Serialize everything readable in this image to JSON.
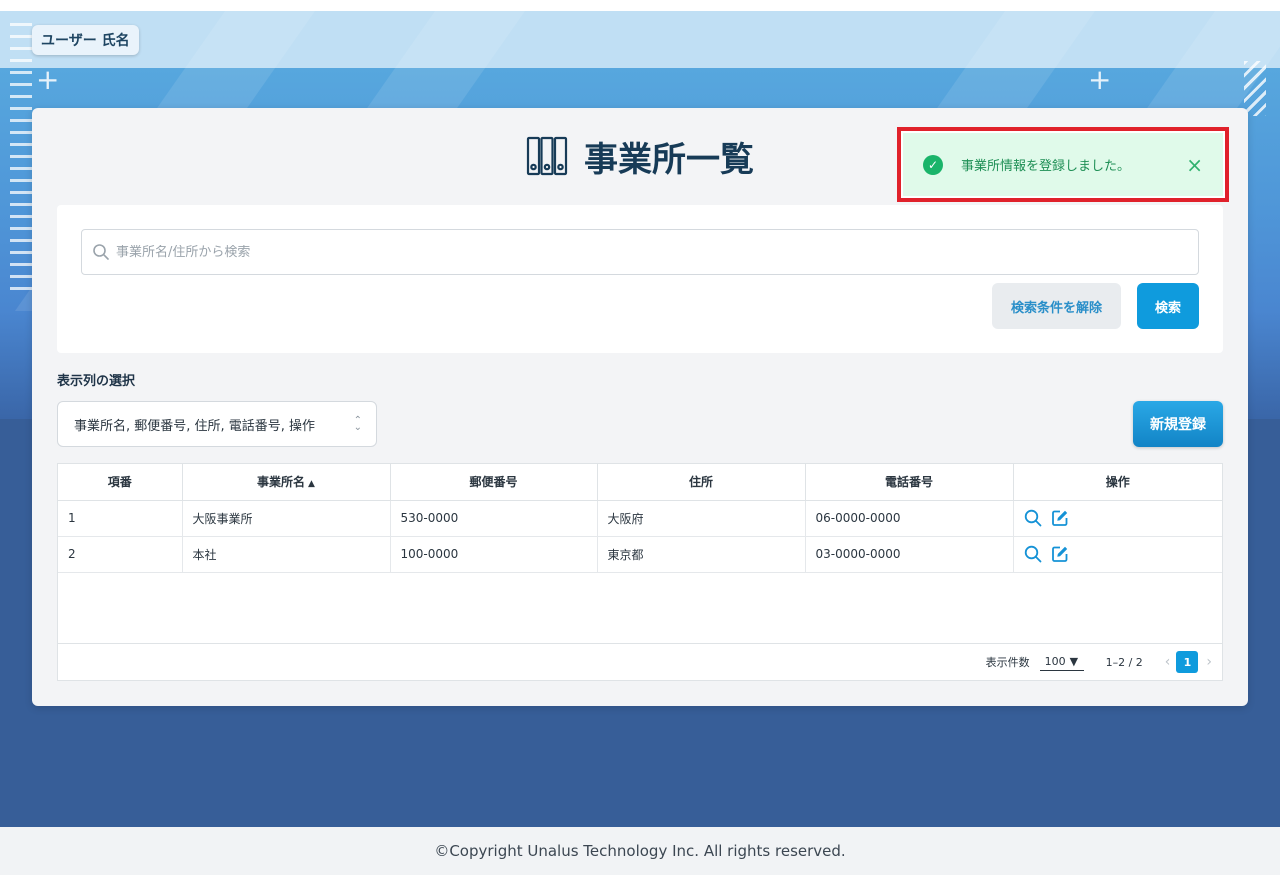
{
  "user": {
    "name": "ユーザー 氏名"
  },
  "page": {
    "title": "事業所一覧"
  },
  "toast": {
    "message": "事業所情報を登録しました。",
    "close_icon": "×"
  },
  "search": {
    "placeholder": "事業所名/住所から検索",
    "value": "",
    "clear_label": "検索条件を解除",
    "search_label": "検索"
  },
  "columns_select": {
    "label": "表示列の選択",
    "value": "事業所名, 郵便番号, 住所, 電話番号, 操作"
  },
  "new_button": {
    "label": "新規登録"
  },
  "table": {
    "headers": [
      "項番",
      "事業所名",
      "郵便番号",
      "住所",
      "電話番号",
      "操作"
    ],
    "sorted_column": "事業所名",
    "sort_direction": "asc",
    "rows": [
      {
        "no": "1",
        "name": "大阪事業所",
        "postal": "530-0000",
        "address": "大阪府",
        "phone": "06-0000-0000"
      },
      {
        "no": "2",
        "name": "本社",
        "postal": "100-0000",
        "address": "東京都",
        "phone": "03-0000-0000"
      }
    ]
  },
  "pagination": {
    "per_page_label": "表示件数",
    "per_page_value": "100",
    "range": "1–2 / 2",
    "current_page": "1"
  },
  "footer": {
    "copyright": "©Copyright Unalus Technology Inc. All rights reserved."
  },
  "colors": {
    "accent": "#0f9bdd",
    "toast_bg": "#e0faea",
    "toast_text": "#1e8f55",
    "highlight_border": "#e0212b",
    "title": "#173b57"
  }
}
